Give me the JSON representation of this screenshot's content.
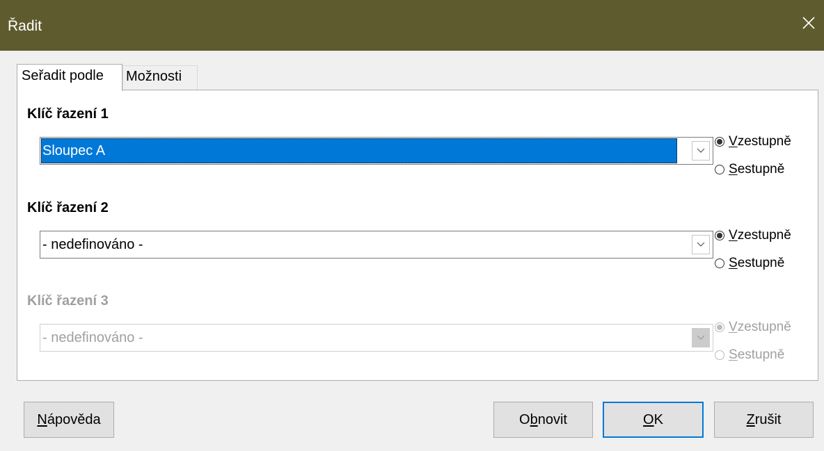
{
  "window": {
    "title": "Řadit",
    "close_icon": "close-icon"
  },
  "tabs": [
    {
      "label": "Seřadit podle",
      "active": true
    },
    {
      "label": "Možnosti",
      "active": false
    }
  ],
  "keys": [
    {
      "heading": "Klíč řazení 1",
      "value": "Sloupec A",
      "selected": true,
      "enabled": true,
      "ascending": {
        "prefix": "",
        "accel": "V",
        "rest": "zestupně",
        "checked": true
      },
      "descending": {
        "prefix": "",
        "accel": "S",
        "rest": "estupně",
        "checked": false
      }
    },
    {
      "heading": "Klíč řazení 2",
      "value": "- nedefinováno -",
      "selected": false,
      "enabled": true,
      "ascending": {
        "prefix": "",
        "accel": "V",
        "rest": "zestupně",
        "checked": true
      },
      "descending": {
        "prefix": "",
        "accel": "S",
        "rest": "estupně",
        "checked": false
      }
    },
    {
      "heading": "Klíč řazení 3",
      "value": "- nedefinováno -",
      "selected": false,
      "enabled": false,
      "ascending": {
        "prefix": "",
        "accel": "V",
        "rest": "zestupně",
        "checked": true
      },
      "descending": {
        "prefix": "",
        "accel": "S",
        "rest": "estupně",
        "checked": false
      }
    }
  ],
  "buttons": {
    "help": {
      "prefix": "",
      "accel": "N",
      "rest": "ápověda"
    },
    "reset": {
      "prefix": "O",
      "accel": "b",
      "rest": "novit"
    },
    "ok": {
      "prefix": "",
      "accel": "O",
      "rest": "K"
    },
    "cancel": {
      "prefix": "",
      "accel": "Z",
      "rest": "rušit"
    }
  },
  "colors": {
    "titlebar": "#5e5c2e",
    "selection": "#0078d7",
    "default_button_border": "#0078d7"
  }
}
